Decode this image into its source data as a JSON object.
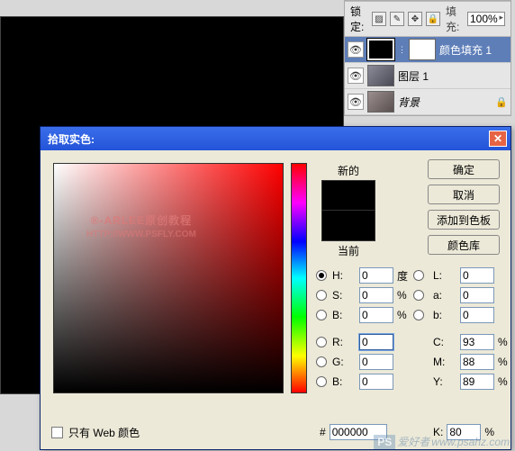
{
  "layers_panel": {
    "lock_label": "锁定:",
    "fill_label": "填充:",
    "fill_value": "100%",
    "items": [
      {
        "name": "颜色填充 1"
      },
      {
        "name": "图层 1"
      },
      {
        "name": "背景"
      }
    ]
  },
  "dialog": {
    "title": "拾取实色:",
    "buttons": {
      "ok": "确定",
      "cancel": "取消",
      "add_swatch": "添加到色板",
      "libraries": "颜色库"
    },
    "preview": {
      "new": "新的",
      "current": "当前"
    },
    "watermark": {
      "line1": "®-ARLEE原创教程",
      "line2": "HTTP://WWW.PSFLY.COM"
    },
    "fields": {
      "H": {
        "label": "H:",
        "value": "0",
        "unit": "度"
      },
      "S": {
        "label": "S:",
        "value": "0",
        "unit": "%"
      },
      "Bv": {
        "label": "B:",
        "value": "0",
        "unit": "%"
      },
      "L": {
        "label": "L:",
        "value": "0"
      },
      "a": {
        "label": "a:",
        "value": "0"
      },
      "b": {
        "label": "b:",
        "value": "0"
      },
      "R": {
        "label": "R:",
        "value": "0"
      },
      "G": {
        "label": "G:",
        "value": "0"
      },
      "Bc": {
        "label": "B:",
        "value": "0"
      },
      "C": {
        "label": "C:",
        "value": "93",
        "unit": "%"
      },
      "M": {
        "label": "M:",
        "value": "88",
        "unit": "%"
      },
      "Y": {
        "label": "Y:",
        "value": "89",
        "unit": "%"
      },
      "K": {
        "label": "K:",
        "value": "80",
        "unit": "%"
      }
    },
    "hex": {
      "label": "#",
      "value": "000000"
    },
    "web_only": "只有 Web 颜色"
  },
  "site_watermark": {
    "ps": "PS",
    "txt": "爱好者",
    "url": "www.psahz.com"
  }
}
